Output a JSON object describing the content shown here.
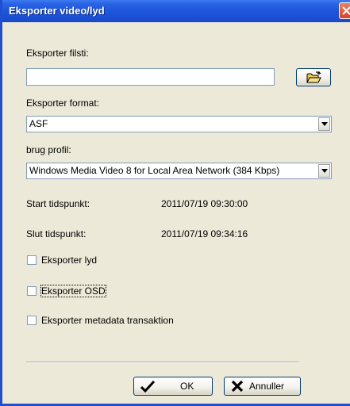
{
  "window": {
    "title": "Eksporter video/lyd",
    "close_icon": "close-icon"
  },
  "path": {
    "label": "Eksporter filsti:",
    "value": "",
    "browse_icon": "folder-open-icon"
  },
  "format": {
    "label": "Eksporter format:",
    "selected": "ASF"
  },
  "profile": {
    "label": "brug profil:",
    "selected": "Windows Media Video 8 for Local Area Network (384 Kbps)"
  },
  "times": {
    "start_label": "Start tidspunkt:",
    "start_value": "2011/07/19 09:30:00",
    "end_label": "Slut tidspunkt:",
    "end_value": "2011/07/19 09:34:16"
  },
  "options": [
    {
      "label": "Eksporter lyd",
      "checked": false
    },
    {
      "label": "Eksporter OSD",
      "checked": false
    },
    {
      "label": "Eksporter metadata transaktion",
      "checked": false
    }
  ],
  "buttons": {
    "ok_label": "OK",
    "ok_icon": "checkmark-icon",
    "cancel_label": "Annuller",
    "cancel_icon": "x-icon"
  },
  "colors": {
    "titlebar": "#1e56dc",
    "dialog_bg": "#ece9d8",
    "close_button": "#d5432a"
  }
}
